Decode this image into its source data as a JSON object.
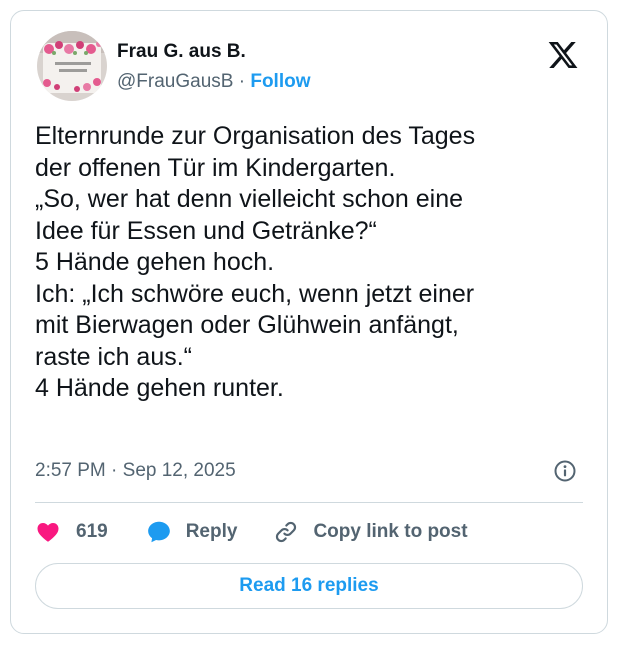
{
  "author": {
    "display_name": "Frau G. aus B.",
    "handle": "@FrauGausB",
    "separator": "·",
    "follow_label": "Follow",
    "avatar_icon": "mug-avatar"
  },
  "brand_icon": "x-logo-icon",
  "tweet": {
    "text": "Elternrunde zur Organisation des Tages\nder offenen Tür im Kindergarten.\n„So, wer hat denn vielleicht schon eine\nIdee für Essen und Getränke?“\n5 Hände gehen hoch.\nIch: „Ich schwöre euch, wenn jetzt einer\nmit Bierwagen oder Glühwein anfängt,\nraste ich aus.“\n4 Hände gehen runter.",
    "timestamp": "2:57 PM · Sep 12, 2025"
  },
  "actions": {
    "like_count": "619",
    "reply_label": "Reply",
    "copy_link_label": "Copy link to post"
  },
  "read_replies_label": "Read 16 replies",
  "colors": {
    "like": "#f91880",
    "reply": "#1d9bf0",
    "link": "#1d9bf0",
    "muted": "#536471",
    "text": "#0f1419",
    "border": "#cfd9de"
  }
}
